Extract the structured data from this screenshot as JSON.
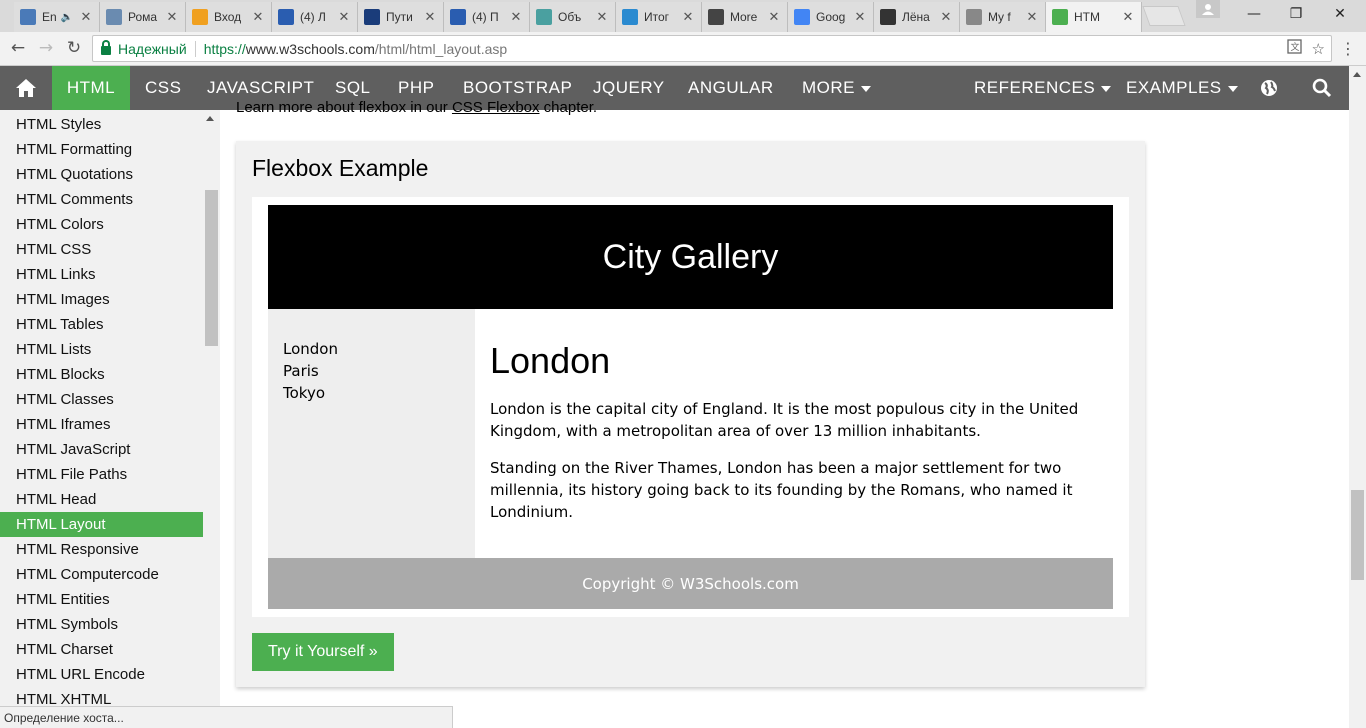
{
  "browser": {
    "tabs": [
      {
        "label": "En",
        "favicon": "play-icon",
        "color": "#4a7ab8",
        "audio": true
      },
      {
        "label": "Рома",
        "favicon": "pause-icon",
        "color": "#6a8bb0"
      },
      {
        "label": "Вход",
        "favicon": "mail-at-icon",
        "color": "#f0a020"
      },
      {
        "label": "(4) Л",
        "favicon": "page-icon",
        "color": "#2a5db0"
      },
      {
        "label": "Пути",
        "favicon": "circle-logo-icon",
        "color": "#1a3c7a"
      },
      {
        "label": "(4) П",
        "favicon": "page-icon",
        "color": "#2a5db0"
      },
      {
        "label": "Объ",
        "favicon": "triangle-icon",
        "color": "#4aa0a0"
      },
      {
        "label": "Итог",
        "favicon": "chat-icon",
        "color": "#2a8ad0"
      },
      {
        "label": "More",
        "favicon": "ibt-icon",
        "color": "#444444"
      },
      {
        "label": "Goog",
        "favicon": "google-icon",
        "color": "#4285f4"
      },
      {
        "label": "Лёна",
        "favicon": "pillars-icon",
        "color": "#333333"
      },
      {
        "label": "My f",
        "favicon": "doc-icon",
        "color": "#888888"
      },
      {
        "label": "HTM",
        "favicon": "w3-icon",
        "color": "#4caf50",
        "active": true
      }
    ],
    "tab_close": "✕",
    "window": {
      "minimize": "—",
      "maximize": "❐",
      "close": "✕"
    },
    "address": {
      "secure_label": "Надежный",
      "url_scheme": "https://",
      "url_host": "www.w3schools.com",
      "url_path": "/html/html_layout.asp"
    },
    "status_text": "Определение хоста..."
  },
  "topnav": {
    "home_icon": "home-icon",
    "items": [
      "HTML",
      "CSS",
      "JAVASCRIPT",
      "SQL",
      "PHP",
      "BOOTSTRAP",
      "JQUERY",
      "ANGULAR",
      "MORE"
    ],
    "right_items": [
      "REFERENCES",
      "EXAMPLES"
    ],
    "globe_icon": "globe-icon",
    "search_icon": "search-icon",
    "bg": "#5f5f5f",
    "accent": "#4caf50"
  },
  "sidebar": {
    "items": [
      "HTML Styles",
      "HTML Formatting",
      "HTML Quotations",
      "HTML Comments",
      "HTML Colors",
      "HTML CSS",
      "HTML Links",
      "HTML Images",
      "HTML Tables",
      "HTML Lists",
      "HTML Blocks",
      "HTML Classes",
      "HTML Iframes",
      "HTML JavaScript",
      "HTML File Paths",
      "HTML Head",
      "HTML Layout",
      "HTML Responsive",
      "HTML Computercode",
      "HTML Entities",
      "HTML Symbols",
      "HTML Charset",
      "HTML URL Encode",
      "HTML XHTML"
    ],
    "active_index": 16
  },
  "main": {
    "intro_prefix": "Learn more about flexbox in our ",
    "intro_link": "CSS Flexbox",
    "intro_suffix": " chapter.",
    "card_title": "Flexbox Example",
    "example": {
      "header": "City Gallery",
      "nav": [
        "London",
        "Paris",
        "Tokyo"
      ],
      "article_title": "London",
      "p1": "London is the capital city of England. It is the most populous city in the United Kingdom, with a metropolitan area of over 13 million inhabitants.",
      "p2": "Standing on the River Thames, London has been a major settlement for two millennia, its history going back to its founding by the Romans, who named it Londinium.",
      "footer": "Copyright © W3Schools.com"
    },
    "try_button": "Try it Yourself »"
  }
}
